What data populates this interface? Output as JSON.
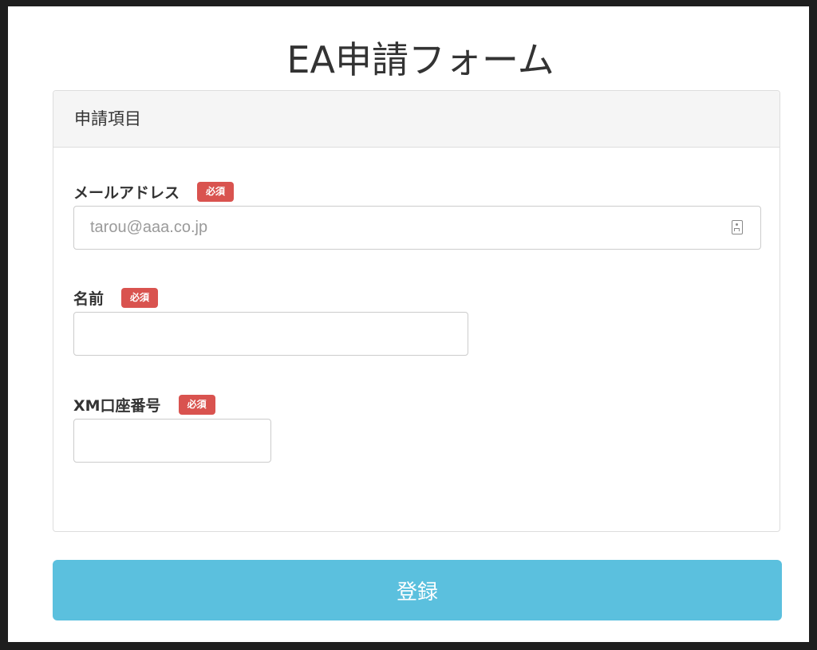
{
  "page": {
    "title": "EA申請フォーム"
  },
  "panel": {
    "heading": "申請項目"
  },
  "form": {
    "required_badge": "必須",
    "email": {
      "label": "メールアドレス",
      "value": "",
      "placeholder": "tarou@aaa.co.jp"
    },
    "name": {
      "label": "名前",
      "value": "",
      "placeholder": ""
    },
    "account": {
      "label": "XM口座番号",
      "value": "",
      "placeholder": ""
    },
    "submit_label": "登録"
  },
  "icons": {
    "email_field_autofill": "contact-card-icon"
  },
  "colors": {
    "primary_button": "#5bc0de",
    "required_badge": "#d9534f",
    "panel_heading_bg": "#f5f5f5",
    "border": "#dddddd"
  }
}
